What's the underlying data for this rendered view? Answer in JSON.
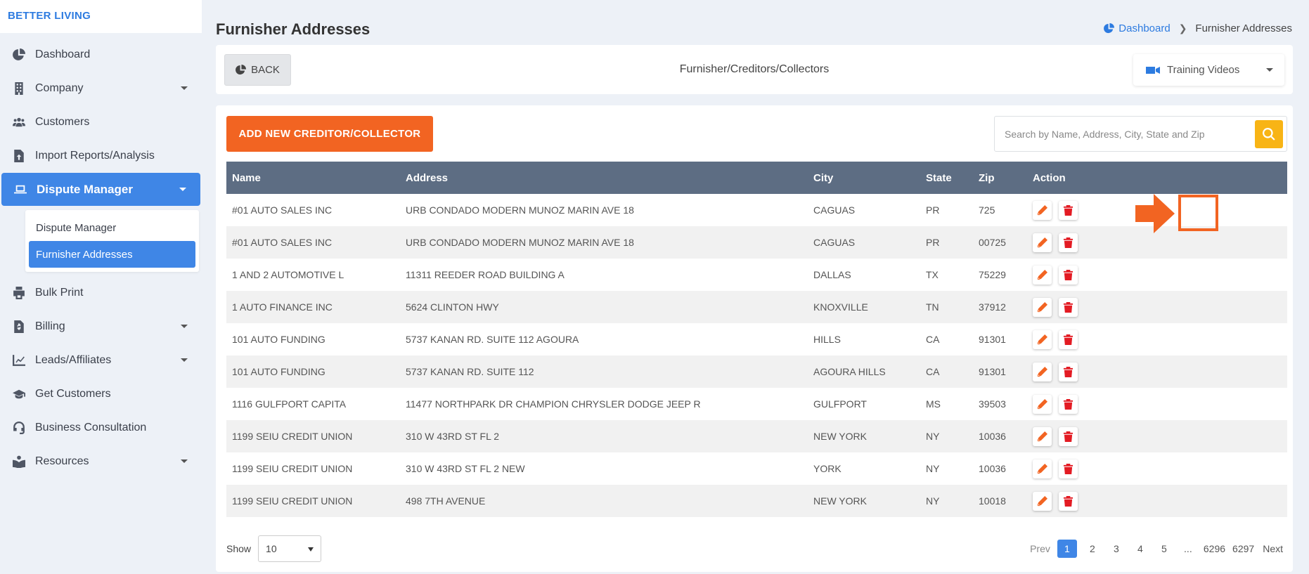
{
  "brand": "BETTER LIVING",
  "sidebar": {
    "items": [
      {
        "label": "Dashboard",
        "icon": "pie-chart-icon",
        "caret": false
      },
      {
        "label": "Company",
        "icon": "building-icon",
        "caret": true
      },
      {
        "label": "Customers",
        "icon": "users-icon",
        "caret": false
      },
      {
        "label": "Import Reports/Analysis",
        "icon": "file-import-icon",
        "caret": false
      },
      {
        "label": "Dispute Manager",
        "icon": "laptop-icon",
        "caret": true,
        "active": true
      },
      {
        "label": "Bulk Print",
        "icon": "printer-icon",
        "caret": false
      },
      {
        "label": "Billing",
        "icon": "invoice-icon",
        "caret": true
      },
      {
        "label": "Leads/Affiliates",
        "icon": "line-chart-icon",
        "caret": true
      },
      {
        "label": "Get Customers",
        "icon": "graduation-cap-icon",
        "caret": false
      },
      {
        "label": "Business Consultation",
        "icon": "headset-icon",
        "caret": false
      },
      {
        "label": "Resources",
        "icon": "book-reader-icon",
        "caret": true
      }
    ],
    "submenu": [
      {
        "label": "Dispute Manager"
      },
      {
        "label": "Furnisher Addresses",
        "active": true
      }
    ]
  },
  "page": {
    "title": "Furnisher Addresses",
    "breadcrumb": {
      "home": "Dashboard",
      "current": "Furnisher Addresses"
    }
  },
  "top_card": {
    "back": "BACK",
    "title": "Furnisher/Creditors/Collectors",
    "training": "Training Videos"
  },
  "content": {
    "add_button": "ADD NEW CREDITOR/COLLECTOR",
    "search_placeholder": "Search by Name, Address, City, State and Zip",
    "columns": [
      "Name",
      "Address",
      "City",
      "State",
      "Zip",
      "Action"
    ],
    "rows": [
      {
        "name": "#01 AUTO SALES INC",
        "address": "URB CONDADO MODERN MUNOZ MARIN AVE 18",
        "city": "CAGUAS",
        "state": "PR",
        "zip": "725"
      },
      {
        "name": "#01 AUTO SALES INC",
        "address": "URB CONDADO MODERN MUNOZ MARIN AVE 18",
        "city": "CAGUAS",
        "state": "PR",
        "zip": "00725"
      },
      {
        "name": "1 AND 2 AUTOMOTIVE L",
        "address": "11311 REEDER ROAD BUILDING A",
        "city": "DALLAS",
        "state": "TX",
        "zip": "75229"
      },
      {
        "name": "1 AUTO FINANCE INC",
        "address": "5624 CLINTON HWY",
        "city": "KNOXVILLE",
        "state": "TN",
        "zip": "37912"
      },
      {
        "name": "101 AUTO FUNDING",
        "address": "5737 KANAN RD. SUITE 112 AGOURA",
        "city": "HILLS",
        "state": "CA",
        "zip": "91301"
      },
      {
        "name": "101 AUTO FUNDING",
        "address": "5737 KANAN RD. SUITE 112",
        "city": "AGOURA HILLS",
        "state": "CA",
        "zip": "91301"
      },
      {
        "name": "1116 GULFPORT CAPITA",
        "address": "11477 NORTHPARK DR CHAMPION CHRYSLER DODGE JEEP R",
        "city": "GULFPORT",
        "state": "MS",
        "zip": "39503"
      },
      {
        "name": "1199 SEIU CREDIT UNION",
        "address": "310 W 43RD ST FL 2",
        "city": "NEW YORK",
        "state": "NY",
        "zip": "10036"
      },
      {
        "name": "1199 SEIU CREDIT UNION",
        "address": "310 W 43RD ST FL 2 NEW",
        "city": "YORK",
        "state": "NY",
        "zip": "10036"
      },
      {
        "name": "1199 SEIU CREDIT UNION",
        "address": "498 7TH AVENUE",
        "city": "NEW YORK",
        "state": "NY",
        "zip": "10018"
      }
    ],
    "show_label": "Show",
    "page_size": "10",
    "pagination": {
      "prev": "Prev",
      "pages": [
        "1",
        "2",
        "3",
        "4",
        "5",
        "...",
        "6296",
        "6297"
      ],
      "active": "1",
      "next": "Next"
    }
  },
  "colors": {
    "accent": "#3f86e6",
    "orange": "#f26422",
    "header": "#5d6d83",
    "search": "#f8b415",
    "delete": "#e31b23"
  }
}
